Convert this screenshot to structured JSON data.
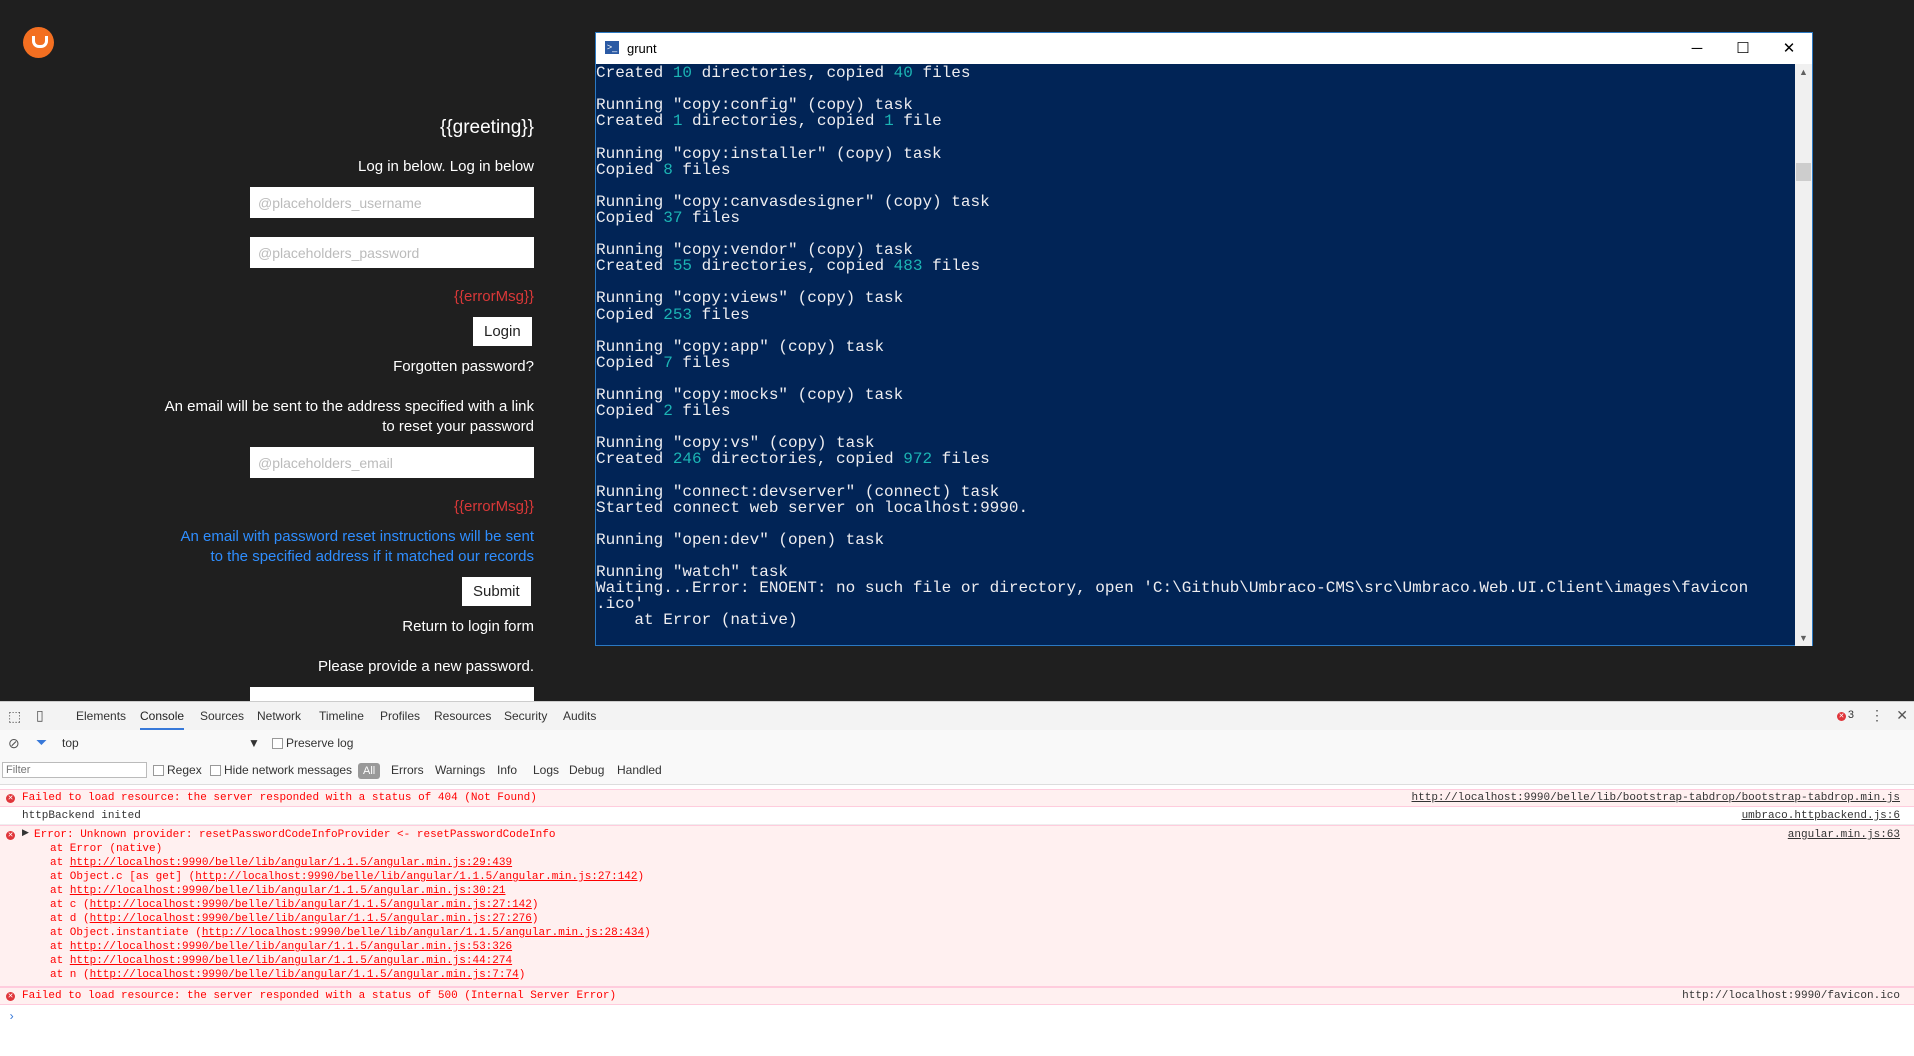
{
  "login": {
    "greeting": "{{greeting}}",
    "instruction": "Log in below. Log in below",
    "username_placeholder": "@placeholders_username",
    "password_placeholder": "@placeholders_password",
    "error_msg": "{{errorMsg}}",
    "login_button": "Login",
    "forgotten_link": "Forgotten password?",
    "reset_info_line1": "An email will be sent to the address specified with a link",
    "reset_info_line2": "to reset your password",
    "email_placeholder": "@placeholders_email",
    "error_msg2": "{{errorMsg}}",
    "sent_info_line1": "An email with password reset instructions will be sent",
    "sent_info_line2": "to the specified address if it matched our records",
    "submit_button": "Submit",
    "return_link": "Return to login form",
    "new_password_prompt": "Please provide a new password."
  },
  "terminal": {
    "title": "grunt",
    "ps_icon": ">_",
    "minimize": "─",
    "maximize": "☐",
    "close": "✕",
    "lines": [
      {
        "parts": [
          {
            "t": "Created "
          },
          {
            "t": "10",
            "n": true
          },
          {
            "t": " directories, copied "
          },
          {
            "t": "40",
            "n": true
          },
          {
            "t": " files"
          }
        ]
      },
      {
        "parts": []
      },
      {
        "parts": [
          {
            "t": "Running \"copy:config\" (copy) task"
          }
        ]
      },
      {
        "parts": [
          {
            "t": "Created "
          },
          {
            "t": "1",
            "n": true
          },
          {
            "t": " directories, copied "
          },
          {
            "t": "1",
            "n": true
          },
          {
            "t": " file"
          }
        ]
      },
      {
        "parts": []
      },
      {
        "parts": [
          {
            "t": "Running \"copy:installer\" (copy) task"
          }
        ]
      },
      {
        "parts": [
          {
            "t": "Copied "
          },
          {
            "t": "8",
            "n": true
          },
          {
            "t": " files"
          }
        ]
      },
      {
        "parts": []
      },
      {
        "parts": [
          {
            "t": "Running \"copy:canvasdesigner\" (copy) task"
          }
        ]
      },
      {
        "parts": [
          {
            "t": "Copied "
          },
          {
            "t": "37",
            "n": true
          },
          {
            "t": " files"
          }
        ]
      },
      {
        "parts": []
      },
      {
        "parts": [
          {
            "t": "Running \"copy:vendor\" (copy) task"
          }
        ]
      },
      {
        "parts": [
          {
            "t": "Created "
          },
          {
            "t": "55",
            "n": true
          },
          {
            "t": " directories, copied "
          },
          {
            "t": "483",
            "n": true
          },
          {
            "t": " files"
          }
        ]
      },
      {
        "parts": []
      },
      {
        "parts": [
          {
            "t": "Running \"copy:views\" (copy) task"
          }
        ]
      },
      {
        "parts": [
          {
            "t": "Copied "
          },
          {
            "t": "253",
            "n": true
          },
          {
            "t": " files"
          }
        ]
      },
      {
        "parts": []
      },
      {
        "parts": [
          {
            "t": "Running \"copy:app\" (copy) task"
          }
        ]
      },
      {
        "parts": [
          {
            "t": "Copied "
          },
          {
            "t": "7",
            "n": true
          },
          {
            "t": " files"
          }
        ]
      },
      {
        "parts": []
      },
      {
        "parts": [
          {
            "t": "Running \"copy:mocks\" (copy) task"
          }
        ]
      },
      {
        "parts": [
          {
            "t": "Copied "
          },
          {
            "t": "2",
            "n": true
          },
          {
            "t": " files"
          }
        ]
      },
      {
        "parts": []
      },
      {
        "parts": [
          {
            "t": "Running \"copy:vs\" (copy) task"
          }
        ]
      },
      {
        "parts": [
          {
            "t": "Created "
          },
          {
            "t": "246",
            "n": true
          },
          {
            "t": " directories, copied "
          },
          {
            "t": "972",
            "n": true
          },
          {
            "t": " files"
          }
        ]
      },
      {
        "parts": []
      },
      {
        "parts": [
          {
            "t": "Running \"connect:devserver\" (connect) task"
          }
        ]
      },
      {
        "parts": [
          {
            "t": "Started connect web server on localhost:9990."
          }
        ]
      },
      {
        "parts": []
      },
      {
        "parts": [
          {
            "t": "Running \"open:dev\" (open) task"
          }
        ]
      },
      {
        "parts": []
      },
      {
        "parts": [
          {
            "t": "Running \"watch\" task"
          }
        ]
      },
      {
        "parts": [
          {
            "t": "Waiting...Error: ENOENT: no such file or directory, open 'C:\\Github\\Umbraco-CMS\\src\\Umbraco.Web.UI.Client\\images\\favicon"
          }
        ]
      },
      {
        "parts": [
          {
            "t": ".ico'"
          }
        ]
      },
      {
        "parts": [
          {
            "t": "    at Error (native)"
          }
        ]
      }
    ]
  },
  "devtools": {
    "tabs": [
      "Elements",
      "Console",
      "Sources",
      "Network",
      "Timeline",
      "Profiles",
      "Resources",
      "Security",
      "Audits"
    ],
    "active_tab": "Console",
    "error_count": "3",
    "context": "top",
    "preserve_log": "Preserve log",
    "filter_placeholder": "Filter",
    "regex": "Regex",
    "hide_network": "Hide network messages",
    "levels": [
      "All",
      "Errors",
      "Warnings",
      "Info",
      "Logs",
      "Debug",
      "Handled"
    ],
    "messages": {
      "m1_text": "Failed to load resource: the server responded with a status of 404 (Not Found)",
      "m1_src": "http://localhost:9990/belle/lib/bootstrap-tabdrop/bootstrap-tabdrop.min.js",
      "m2_text": "httpBackend inited",
      "m2_src": "umbraco.httpbackend.js:6",
      "m3_text": "Error: Unknown provider: resetPasswordCodeInfoProvider <- resetPasswordCodeInfo",
      "m3_src": "angular.min.js:63",
      "stack": [
        {
          "pre": "at Error (native)",
          "link": "",
          "post": ""
        },
        {
          "pre": "at ",
          "link": "http://localhost:9990/belle/lib/angular/1.1.5/angular.min.js:29:439",
          "post": ""
        },
        {
          "pre": "at Object.c [as get] (",
          "link": "http://localhost:9990/belle/lib/angular/1.1.5/angular.min.js:27:142",
          "post": ")"
        },
        {
          "pre": "at ",
          "link": "http://localhost:9990/belle/lib/angular/1.1.5/angular.min.js:30:21",
          "post": ""
        },
        {
          "pre": "at c (",
          "link": "http://localhost:9990/belle/lib/angular/1.1.5/angular.min.js:27:142",
          "post": ")"
        },
        {
          "pre": "at d (",
          "link": "http://localhost:9990/belle/lib/angular/1.1.5/angular.min.js:27:276",
          "post": ")"
        },
        {
          "pre": "at Object.instantiate (",
          "link": "http://localhost:9990/belle/lib/angular/1.1.5/angular.min.js:28:434",
          "post": ")"
        },
        {
          "pre": "at ",
          "link": "http://localhost:9990/belle/lib/angular/1.1.5/angular.min.js:53:326",
          "post": ""
        },
        {
          "pre": "at ",
          "link": "http://localhost:9990/belle/lib/angular/1.1.5/angular.min.js:44:274",
          "post": ""
        },
        {
          "pre": "at n (",
          "link": "http://localhost:9990/belle/lib/angular/1.1.5/angular.min.js:7:74",
          "post": ")"
        }
      ],
      "m4_text": "Failed to load resource: the server responded with a status of 500 (Internal Server Error)",
      "m4_src": "http://localhost:9990/favicon.ico"
    }
  }
}
